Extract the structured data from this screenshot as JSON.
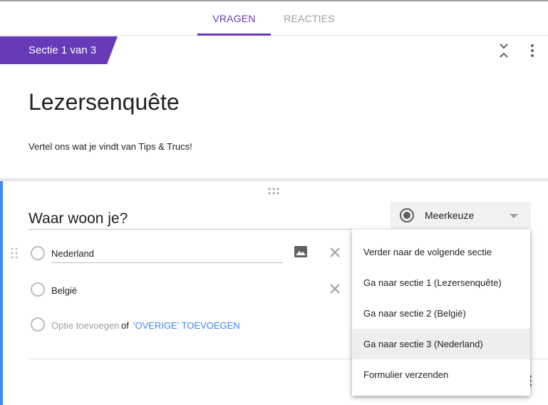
{
  "tabs": [
    {
      "label": "VRAGEN",
      "active": true
    },
    {
      "label": "REACTIES",
      "active": false
    }
  ],
  "section": {
    "label": "Sectie 1 van 3",
    "title": "Lezersenquête",
    "description": "Vertel ons wat je vindt van Tips & Trucs!"
  },
  "question": {
    "title": "Waar woon je?",
    "type": "Meerkeuze",
    "options": [
      {
        "label": "Nederland"
      },
      {
        "label": "België"
      }
    ],
    "add_option": "Optie toevoegen",
    "add_of": "of",
    "add_other": "'OVERIGE' TOEVOEGEN"
  },
  "menu": {
    "items": [
      {
        "label": "Verder naar de volgende sectie"
      },
      {
        "label": "Ga naar sectie 1 (Lezersenquête)"
      },
      {
        "label": "Ga naar sectie 2 (België)"
      },
      {
        "label": "Ga naar sectie 3 (Nederland)",
        "highlighted": true
      },
      {
        "label": "Formulier verzenden"
      }
    ]
  },
  "colors": {
    "accent": "#673ab7",
    "focus": "#4285f4"
  },
  "icons": [
    "collapse-icon",
    "more-vert-icon",
    "drag-handle-icon",
    "image-icon",
    "close-icon",
    "radio-filled-icon",
    "caret-down-icon"
  ]
}
